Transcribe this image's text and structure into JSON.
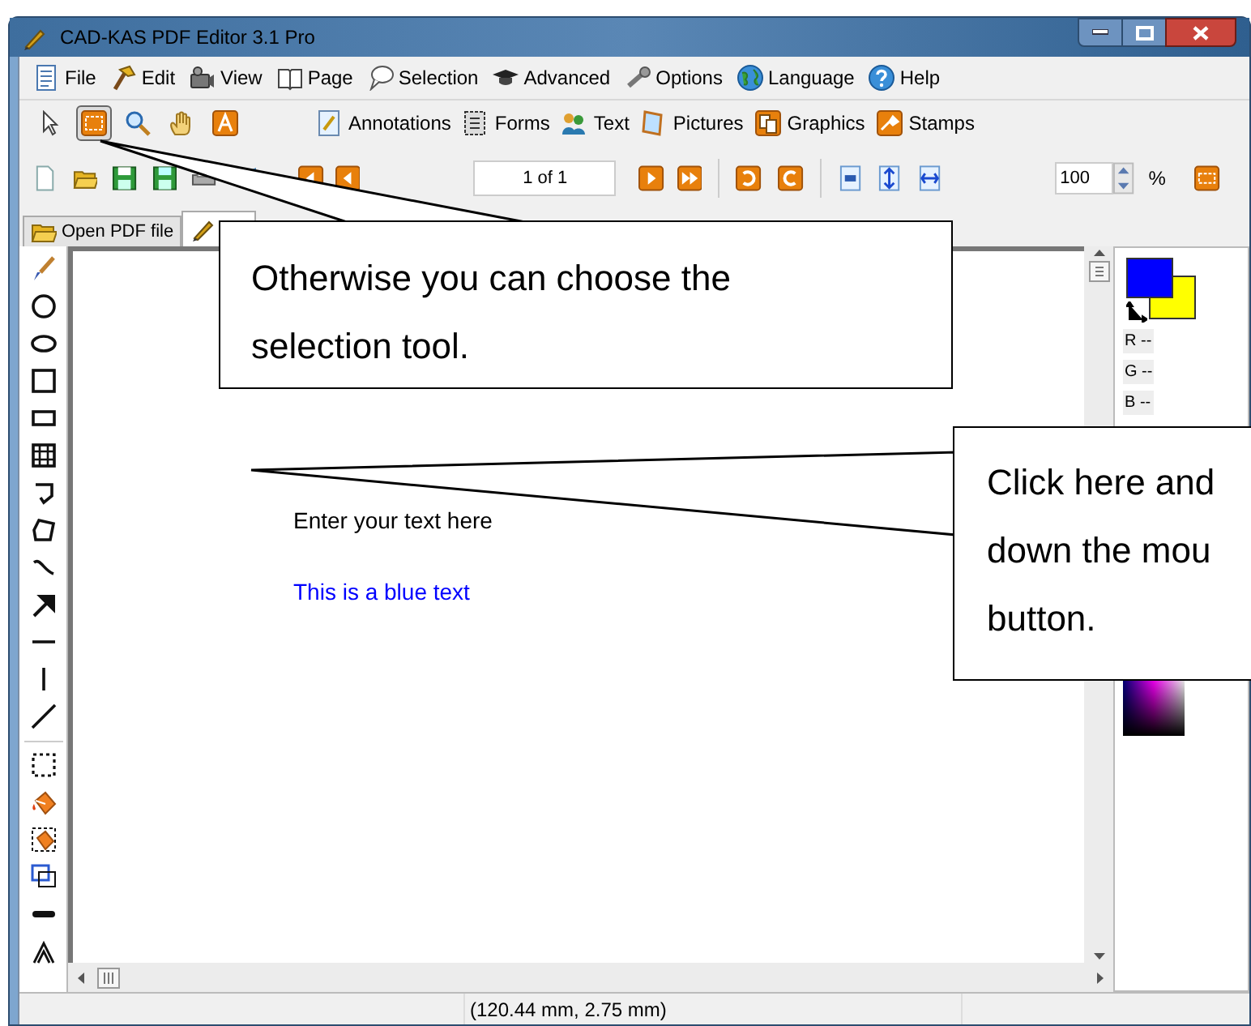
{
  "window": {
    "title": "CAD-KAS PDF Editor 3.1 Pro"
  },
  "menu": [
    {
      "label": "File"
    },
    {
      "label": "Edit"
    },
    {
      "label": "View"
    },
    {
      "label": "Page"
    },
    {
      "label": "Selection"
    },
    {
      "label": "Advanced"
    },
    {
      "label": "Options"
    },
    {
      "label": "Language"
    },
    {
      "label": "Help"
    }
  ],
  "tools": [
    {
      "selected": false
    },
    {
      "selected": true
    },
    {
      "selected": false
    },
    {
      "selected": false
    },
    {
      "selected": false
    }
  ],
  "modes": [
    {
      "label": "Annotations"
    },
    {
      "label": "Forms"
    },
    {
      "label": "Text"
    },
    {
      "label": "Pictures"
    },
    {
      "label": "Graphics"
    },
    {
      "label": "Stamps"
    }
  ],
  "page_field": {
    "value": "1 of 1"
  },
  "zoom_field": {
    "value": "100",
    "unit": "%"
  },
  "tabs": [
    {
      "label": "Open PDF file",
      "selected": false
    },
    {
      "selected": true
    }
  ],
  "canvas_texts": [
    {
      "text": "Enter your text here",
      "color": "#000000"
    },
    {
      "text": "This is a blue text",
      "color": "#0000ff"
    }
  ],
  "color_panel": {
    "channels": [
      "R --",
      "G --",
      "B --"
    ]
  },
  "status_bar": {
    "coordinates": "(120.44 mm, 2.75 mm)"
  },
  "callouts": [
    {
      "lines": [
        "Otherwise you can choose the",
        "selection tool."
      ]
    },
    {
      "lines": [
        "Click here and",
        "down the mou",
        "button."
      ]
    }
  ]
}
